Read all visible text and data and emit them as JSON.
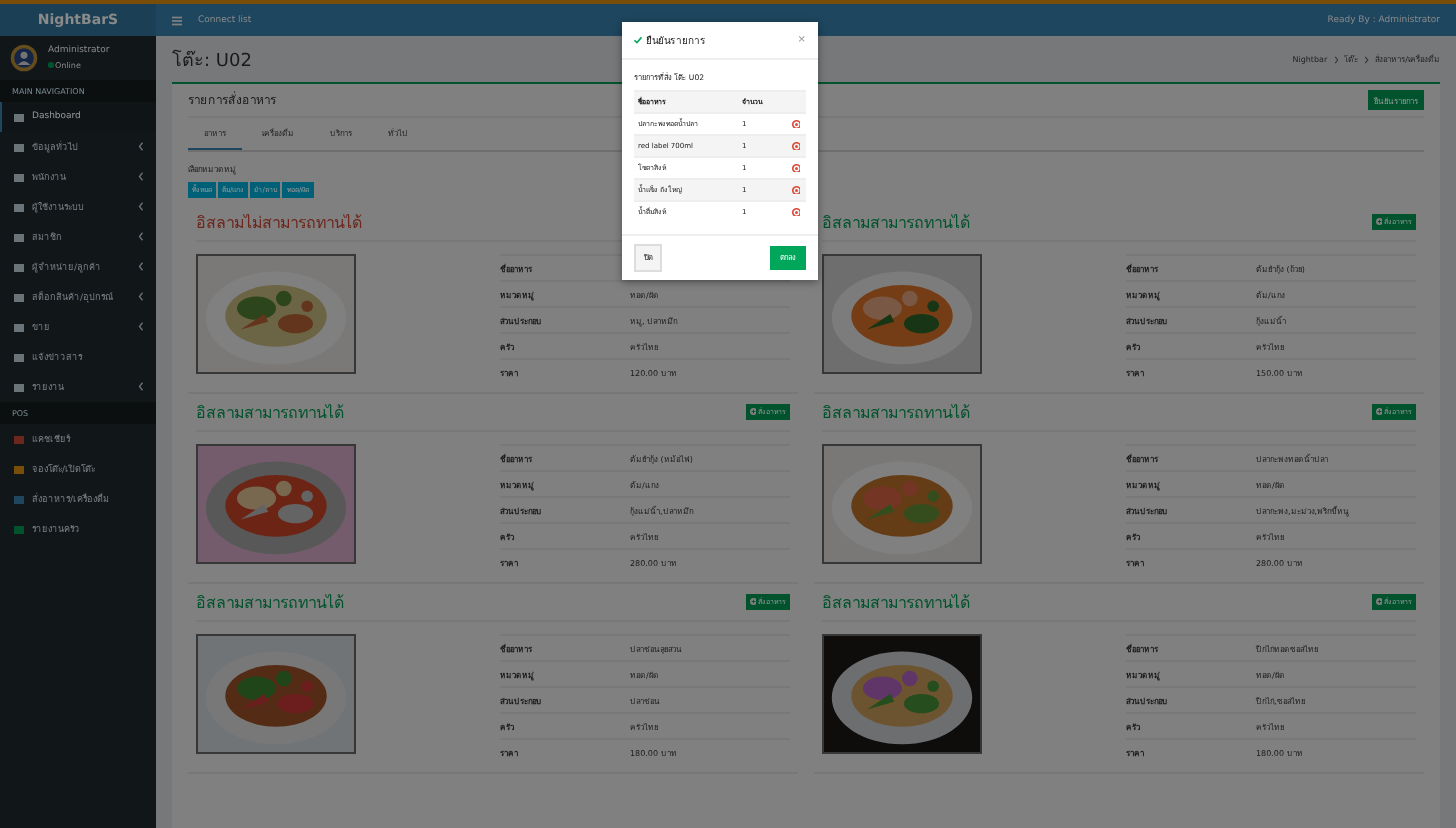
{
  "brand": "NightBarS",
  "user": {
    "name": "Administrator",
    "status": "Online"
  },
  "sidebar": {
    "header": "MAIN NAVIGATION",
    "items": [
      {
        "label": "Dashboard",
        "selected": true,
        "has_submenu": false
      },
      {
        "label": "ข้อมูลทั่วไป",
        "selected": false,
        "has_submenu": true
      },
      {
        "label": "พนักงาน",
        "selected": false,
        "has_submenu": true
      },
      {
        "label": "ผู้ใช้งานระบบ",
        "selected": false,
        "has_submenu": true
      },
      {
        "label": "สมาชิก",
        "selected": false,
        "has_submenu": true
      },
      {
        "label": "ผู้จำหน่าย/ลูกค้า",
        "selected": false,
        "has_submenu": true
      },
      {
        "label": "สต็อกสินค้า/อุปกรณ์",
        "selected": false,
        "has_submenu": true
      },
      {
        "label": "ขาย",
        "selected": false,
        "has_submenu": true
      },
      {
        "label": "แจ้งข่าวสาร",
        "selected": false,
        "has_submenu": false
      },
      {
        "label": "รายงาน",
        "selected": false,
        "has_submenu": true
      }
    ],
    "header_2": "POS",
    "pos_items": [
      {
        "label": "แคชเชียร์",
        "color": "#6e251c"
      },
      {
        "label": "จองโต๊ะ/เปิดโต๊ะ",
        "color": "#794e09"
      },
      {
        "label": "สั่งอาหาร/เครื่องดื่ม",
        "color": "#1e465e"
      },
      {
        "label": "รายงานครัว",
        "color": "#00532d"
      }
    ]
  },
  "topbar": {
    "link": "Connect list",
    "ready_by": "Ready By : Administrator"
  },
  "page": {
    "title": "โต๊ะ: U02",
    "breadcrumb": [
      "Nightbar",
      "โต๊ะ",
      "สั่งอาหาร/เครื่องดื่ม"
    ]
  },
  "panel": {
    "title": "รายการสั่งอาหาร",
    "confirm_button": "ยืนยันรายการ",
    "tabs": [
      {
        "label": "อาหาร",
        "selected": true
      },
      {
        "label": "เครื่องดื่ม",
        "selected": false
      },
      {
        "label": "บริการ",
        "selected": false
      },
      {
        "label": "ทั่วไป",
        "selected": false
      }
    ],
    "filter_label": "เลือกหมวดหมู่",
    "categories": [
      "ทั้งหมด",
      "ต้ม/แกง",
      "ยำ/ลาบ",
      "ทอด/ผัด"
    ],
    "cards": [
      {
        "heading": "อิสลามไม่สามารถทานได้",
        "color": "#6e251c",
        "rows": [
          {
            "label": "ชื่ออาหาร"
          },
          {
            "label": "หมวดหมู่",
            "value": "ทอด/ผัด"
          },
          {
            "label": "ส่วนประกอบ",
            "value": "หมู, ปลาหมึก"
          },
          {
            "label": "ครัว",
            "value": "ครัวไทย"
          },
          {
            "label": "ราคา",
            "value": "120.00 บาท"
          }
        ]
      },
      {
        "heading": "อิสลามสามารถทานได้",
        "color": "#00532d",
        "order_button": "สั่งอาหาร",
        "rows": [
          {
            "label": "ชื่ออาหาร",
            "value": "ต้มยำกุ้ง (ถ้วย)"
          },
          {
            "label": "หมวดหมู่",
            "value": "ต้ม/แกง"
          },
          {
            "label": "ส่วนประกอบ",
            "value": "กุ้งแม่น้ำ"
          },
          {
            "label": "ครัว",
            "value": "ครัวไทย"
          },
          {
            "label": "ราคา",
            "value": "150.00 บาท"
          }
        ]
      },
      {
        "heading": "อิสลามสามารถทานได้",
        "color": "#00532d",
        "order_button": "สั่งอาหาร",
        "rows": [
          {
            "label": "ชื่ออาหาร",
            "value": "ต้มยำกุ้ง (หม้อไฟ)"
          },
          {
            "label": "หมวดหมู่",
            "value": "ต้ม/แกง"
          },
          {
            "label": "ส่วนประกอบ",
            "value": "กุ้งแม่น้ำ,ปลาหมึก"
          },
          {
            "label": "ครัว",
            "value": "ครัวไทย"
          },
          {
            "label": "ราคา",
            "value": "280.00 บาท"
          }
        ]
      },
      {
        "heading": "อิสลามสามารถทานได้",
        "color": "#00532d",
        "order_button": "สั่งอาหาร",
        "rows": [
          {
            "label": "ชื่ออาหาร",
            "value": "ปลากะพงทอดน้ำปลา"
          },
          {
            "label": "หมวดหมู่",
            "value": "ทอด/ผัด"
          },
          {
            "label": "ส่วนประกอบ",
            "value": "ปลากะพง,มะม่วง,พริกขี้หนู"
          },
          {
            "label": "ครัว",
            "value": "ครัวไทย"
          },
          {
            "label": "ราคา",
            "value": "280.00 บาท"
          }
        ]
      },
      {
        "heading": "อิสลามสามารถทานได้",
        "color": "#00532d",
        "order_button": "สั่งอาหาร",
        "rows": [
          {
            "label": "ชื่ออาหาร",
            "value": "ปลาช่อนลุยสวน"
          },
          {
            "label": "หมวดหมู่",
            "value": "ทอด/ผัด"
          },
          {
            "label": "ส่วนประกอบ",
            "value": "ปลาช่อน"
          },
          {
            "label": "ครัว",
            "value": "ครัวไทย"
          },
          {
            "label": "ราคา",
            "value": "180.00 บาท"
          }
        ]
      },
      {
        "heading": "อิสลามสามารถทานได้",
        "color": "#00532d",
        "order_button": "สั่งอาหาร",
        "rows": [
          {
            "label": "ชื่ออาหาร",
            "value": "ปีกไก่ทอดซอสไทย"
          },
          {
            "label": "หมวดหมู่",
            "value": "ทอด/ผัด"
          },
          {
            "label": "ส่วนประกอบ",
            "value": "ปีกไก่,ซอสไทย"
          },
          {
            "label": "ครัว",
            "value": "ครัวไทย"
          },
          {
            "label": "ราคา",
            "value": "180.00 บาท"
          }
        ]
      }
    ]
  },
  "modal": {
    "title": "ยืนยันรายการ",
    "close": "×",
    "subtitle": "รายการที่สั่ง โต๊ะ U02",
    "columns": [
      "ชื่ออาหาร",
      "จำนวน"
    ],
    "rows": [
      {
        "name": "ปลากะพงทอดน้ำปลา",
        "qty": "1"
      },
      {
        "name": "red label 700ml",
        "qty": "1"
      },
      {
        "name": "โซดาสิงห์",
        "qty": "1"
      },
      {
        "name": "น้ำแข็ง ถังใหญ่",
        "qty": "1"
      },
      {
        "name": "น้ำดื่มสิงห์",
        "qty": "1"
      }
    ],
    "cancel_button": "ปิด",
    "ok_button": "ตกลง"
  }
}
